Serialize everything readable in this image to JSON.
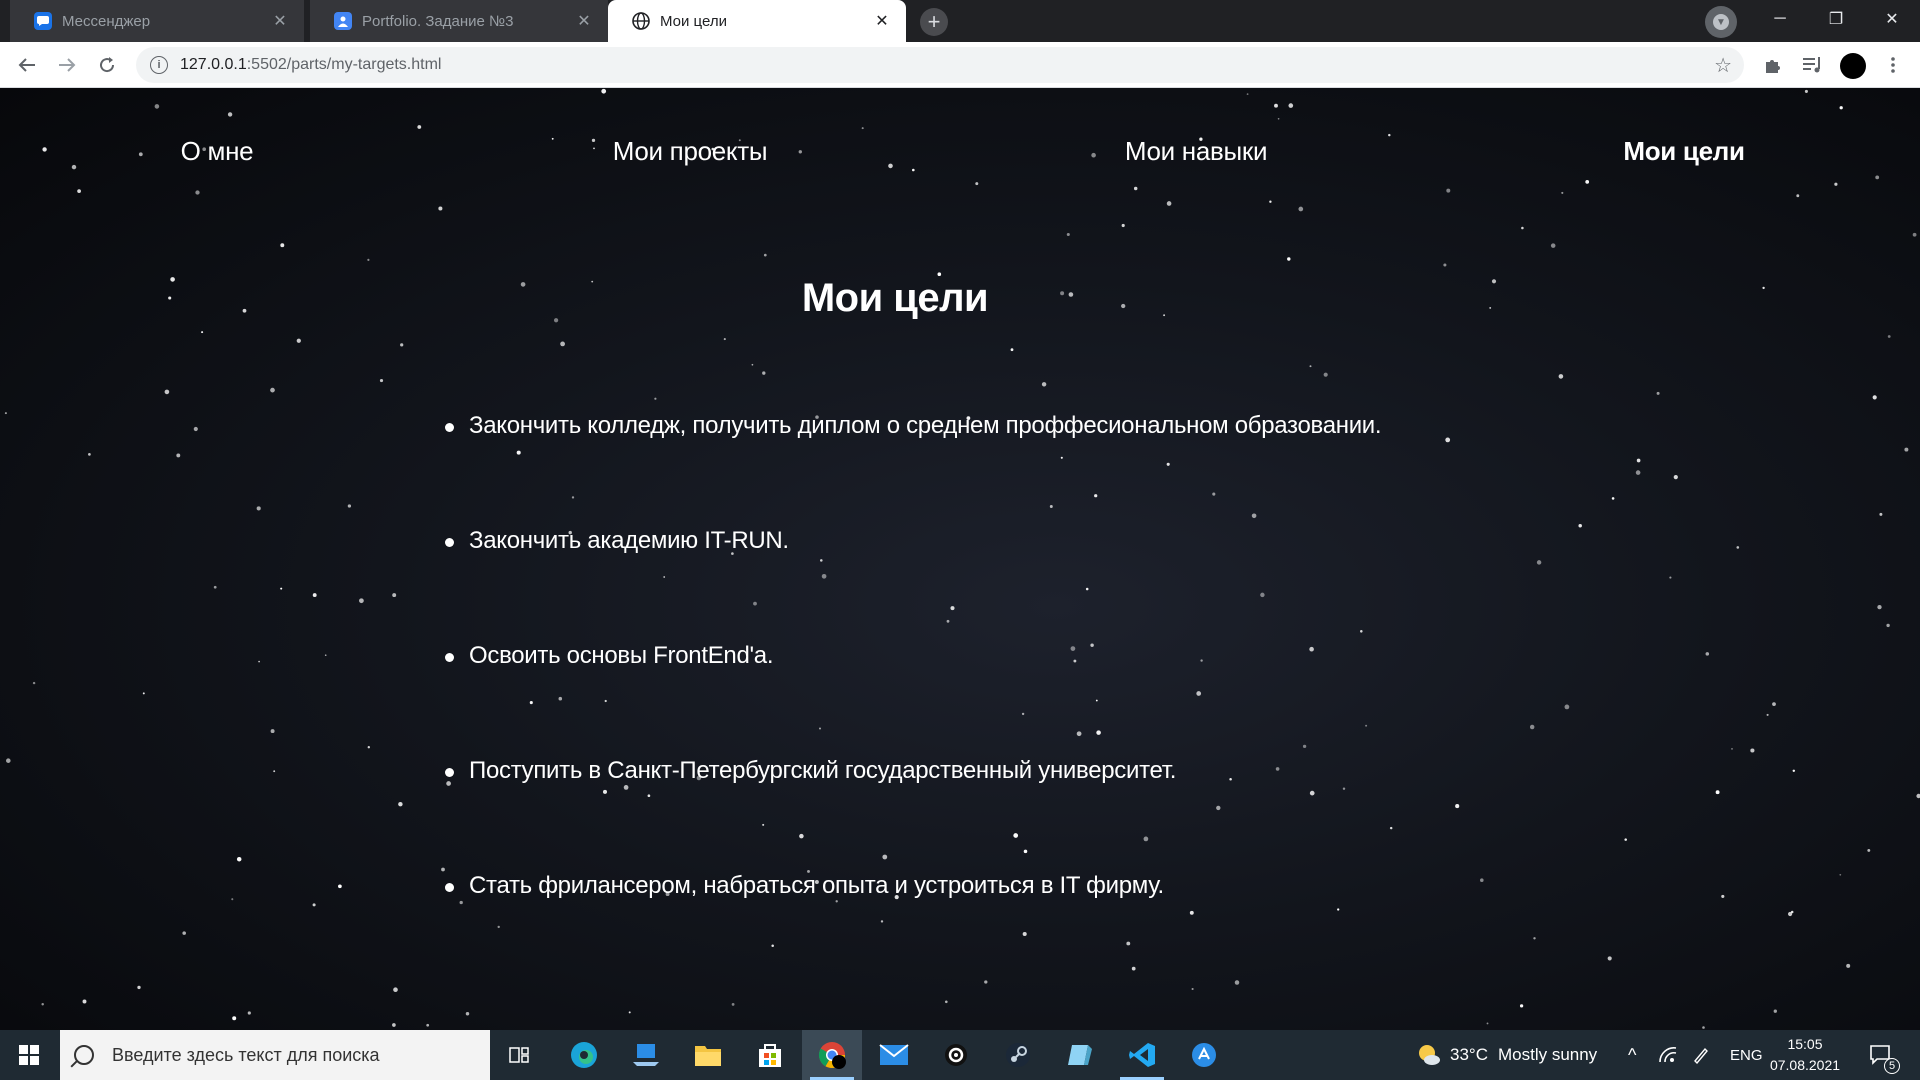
{
  "browser": {
    "tabs": [
      {
        "title": "Мессенджер",
        "icon": "messenger-icon",
        "active": false
      },
      {
        "title": "Portfolio. Задание №3",
        "icon": "portfolio-icon",
        "active": false
      },
      {
        "title": "Мои цели",
        "icon": "globe-icon",
        "active": true
      }
    ],
    "url_host": "127.0.0.1",
    "url_rest": ":5502/parts/my-targets.html"
  },
  "nav": {
    "items": [
      {
        "label": "О мне",
        "current": false
      },
      {
        "label": "Мои проекты",
        "current": false
      },
      {
        "label": "Мои навыки",
        "current": false
      },
      {
        "label": "Мои цели",
        "current": true
      }
    ]
  },
  "main": {
    "title": "Мои цели",
    "goals": [
      "Закончить колледж, получить диплом о среднем проффесиональном образовании.",
      "Закончить академию IT-RUN.",
      "Освоить основы FrontEnd'a.",
      "Поступить в Санкт-Петербургский государственный университет.",
      "Стать фрилансером, набраться опыта и устроиться в IT фирму."
    ]
  },
  "taskbar": {
    "search_placeholder": "Введите здесь текст для поиска",
    "apps": [
      "task-view-icon",
      "edge-icon",
      "devices-icon",
      "file-explorer-icon",
      "store-icon",
      "chrome-icon",
      "mail-icon",
      "app-icon",
      "steam-icon",
      "app2-icon",
      "vscode-icon",
      "app3-icon"
    ],
    "weather_temp": "33°C",
    "weather_text": "Mostly sunny",
    "language": "ENG",
    "time": "15:05",
    "date": "07.08.2021",
    "notifications": "5"
  },
  "colors": {
    "page_bg": "#12151c",
    "text": "#ffffff",
    "taskbar": "#1f2a33"
  }
}
